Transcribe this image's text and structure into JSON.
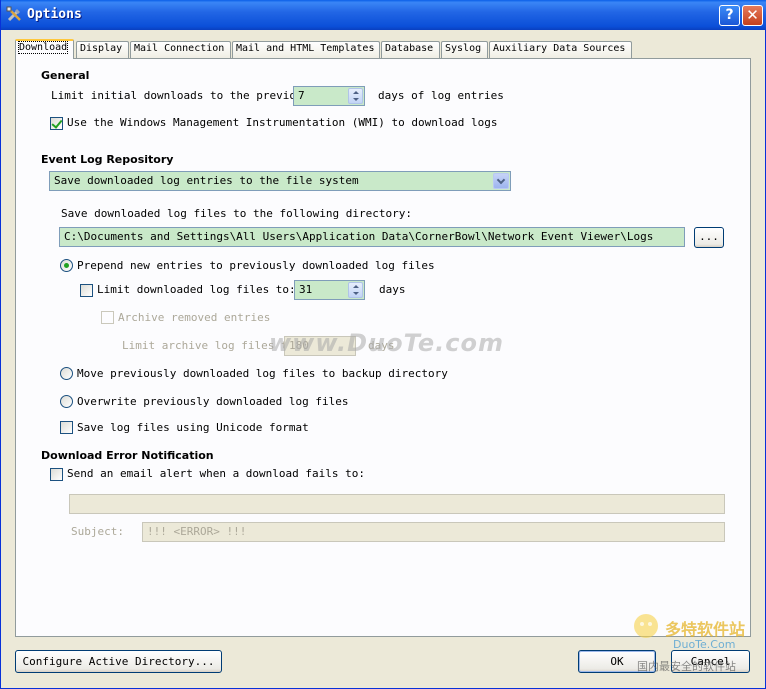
{
  "window": {
    "title": "Options",
    "help_label": "?",
    "close_label": "✕"
  },
  "tabs": [
    {
      "label": "Download"
    },
    {
      "label": "Display"
    },
    {
      "label": "Mail Connection"
    },
    {
      "label": "Mail and HTML Templates"
    },
    {
      "label": "Database"
    },
    {
      "label": "Syslog"
    },
    {
      "label": "Auxiliary Data Sources"
    }
  ],
  "general": {
    "heading": "General",
    "limit_label": "Limit initial downloads to the previous",
    "limit_value": "7",
    "limit_suffix": "days of log entries",
    "wmi_label": "Use the Windows Management Instrumentation (WMI) to download logs"
  },
  "repository": {
    "heading": "Event Log Repository",
    "mode_selected": "Save downloaded log entries to the file system",
    "dir_label": "Save downloaded log files to the following directory:",
    "dir_value": "C:\\Documents and Settings\\All Users\\Application Data\\CornerBowl\\Network Event Viewer\\Logs",
    "browse_label": "...",
    "prepend_label": "Prepend new entries to previously downloaded log files",
    "limit_files_label": "Limit downloaded log files to:",
    "limit_files_value": "31",
    "limit_files_suffix": "days",
    "archive_label": "Archive removed entries",
    "archive_limit_label": "Limit archive log files to:",
    "archive_limit_value": "180",
    "archive_limit_suffix": "days",
    "move_label": "Move previously downloaded log files to backup directory",
    "overwrite_label": "Overwrite previously downloaded log files",
    "unicode_label": "Save log files using Unicode format"
  },
  "notification": {
    "heading": "Download Error Notification",
    "email_label": "Send an email alert when a download fails to:",
    "email_value": "",
    "subject_label": "Subject:",
    "subject_value": "!!! <ERROR> !!!"
  },
  "footer": {
    "ad_button": "Configure Active Directory...",
    "ok_button": "OK",
    "cancel_button": "Cancel"
  },
  "watermark": {
    "center_text": "www.DuoTe.com",
    "corner_line1": "多特软件站",
    "corner_line2": "DuoTe.Com",
    "corner_line3": "国内最安全的软件站"
  },
  "colors": {
    "titlebar": "#0a5fe8",
    "field_bg": "#c9e9c9",
    "panel_bg": "#fcfcfe",
    "window_bg": "#ece9d8",
    "checkmark": "#21a121"
  }
}
